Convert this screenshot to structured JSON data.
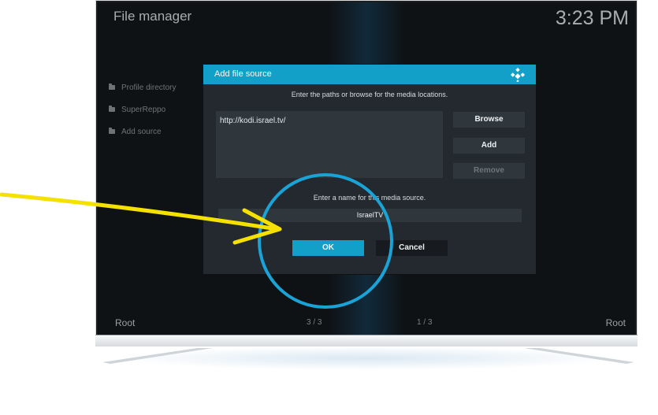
{
  "screen": {
    "title": "File manager",
    "clock": "3:23 PM",
    "sidebar": {
      "items": [
        {
          "label": "Profile directory",
          "icon": "folder-icon"
        },
        {
          "label": "SuperReppo",
          "icon": "folder-icon"
        },
        {
          "label": "Add source",
          "icon": "folder-icon"
        }
      ]
    },
    "footer": {
      "left_label": "Root",
      "left_count": "3 / 3",
      "right_count": "1 / 3",
      "right_label": "Root"
    }
  },
  "dialog": {
    "title": "Add file source",
    "subtitle": "Enter the paths or browse for the media locations.",
    "paths": [
      "http://kodi.israel.tv/"
    ],
    "buttons": {
      "browse": "Browse",
      "add": "Add",
      "remove": "Remove"
    },
    "name_label": "Enter a name for this media source.",
    "name_value": "IsraelTV",
    "ok": "OK",
    "cancel": "Cancel"
  },
  "colors": {
    "accent": "#12a0c9",
    "annotation_arrow": "#f5e100",
    "annotation_circle": "#1aa3d6"
  }
}
